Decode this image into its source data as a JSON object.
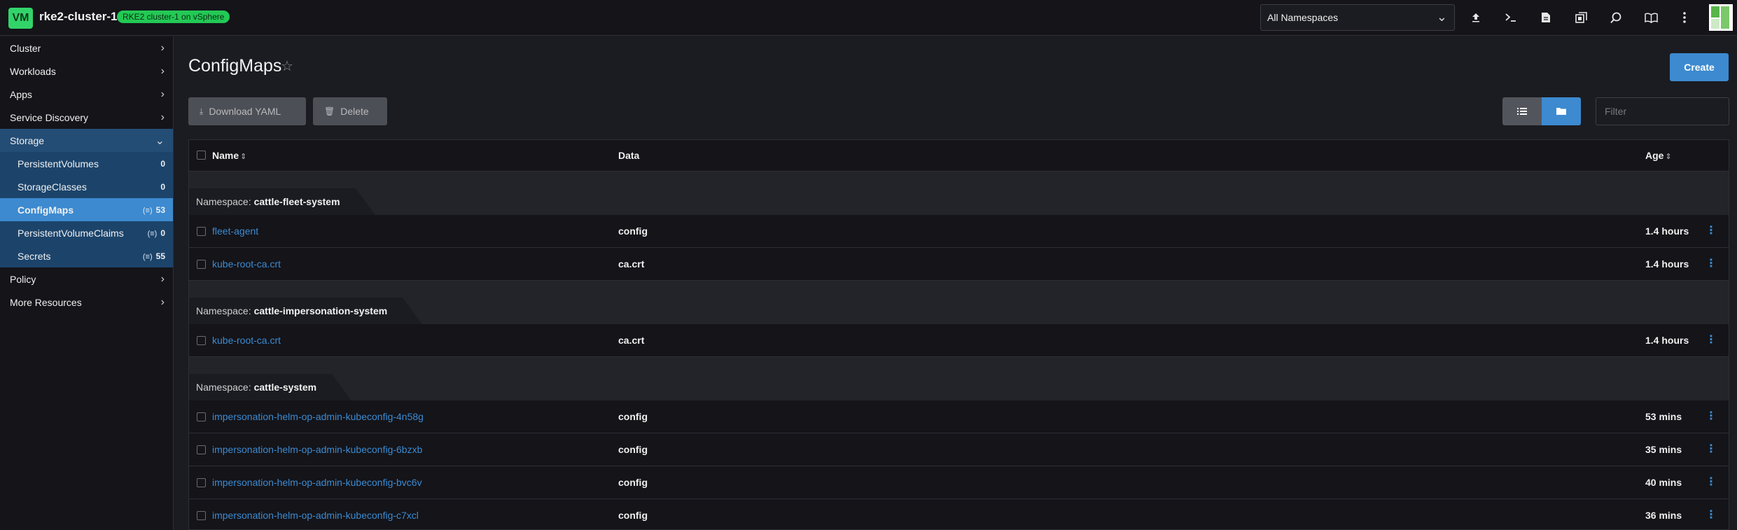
{
  "header": {
    "cluster_initials": "VM",
    "cluster_name": "rke2-cluster-1",
    "cluster_description": "RKE2 cluster-1 on vSphere",
    "namespace_select": "All Namespaces",
    "icons": [
      "upload-icon",
      "kubectl-shell-icon",
      "file-icon",
      "copy-kubeconfig-icon",
      "search-icon",
      "book-icon",
      "more-vertical-icon"
    ]
  },
  "sidebar": {
    "groups": [
      {
        "label": "Cluster"
      },
      {
        "label": "Workloads"
      },
      {
        "label": "Apps"
      },
      {
        "label": "Service Discovery"
      },
      {
        "label": "Storage"
      },
      {
        "label": "Policy"
      },
      {
        "label": "More Resources"
      }
    ],
    "storage_items": [
      {
        "label": "PersistentVolumes",
        "count": "0",
        "ns_glyph": ""
      },
      {
        "label": "StorageClasses",
        "count": "0",
        "ns_glyph": ""
      },
      {
        "label": "ConfigMaps",
        "count": "53",
        "ns_glyph": "(≡)"
      },
      {
        "label": "PersistentVolumeClaims",
        "count": "0",
        "ns_glyph": "(≡)"
      },
      {
        "label": "Secrets",
        "count": "55",
        "ns_glyph": "(≡)"
      }
    ]
  },
  "main": {
    "title": "ConfigMaps",
    "create_label": "Create",
    "download_label": "Download YAML",
    "delete_label": "Delete",
    "filter_placeholder": "Filter",
    "columns": {
      "name": "Name",
      "data": "Data",
      "age": "Age"
    },
    "namespace_prefix": "Namespace:",
    "groups": [
      {
        "namespace": "cattle-fleet-system",
        "rows": [
          {
            "name": "fleet-agent",
            "data": "config",
            "age": "1.4 hours"
          },
          {
            "name": "kube-root-ca.crt",
            "data": "ca.crt",
            "age": "1.4 hours"
          }
        ]
      },
      {
        "namespace": "cattle-impersonation-system",
        "rows": [
          {
            "name": "kube-root-ca.crt",
            "data": "ca.crt",
            "age": "1.4 hours"
          }
        ]
      },
      {
        "namespace": "cattle-system",
        "rows": [
          {
            "name": "impersonation-helm-op-admin-kubeconfig-4n58g",
            "data": "config",
            "age": "53 mins"
          },
          {
            "name": "impersonation-helm-op-admin-kubeconfig-6bzxb",
            "data": "config",
            "age": "35 mins"
          },
          {
            "name": "impersonation-helm-op-admin-kubeconfig-bvc6v",
            "data": "config",
            "age": "40 mins"
          },
          {
            "name": "impersonation-helm-op-admin-kubeconfig-c7xcl",
            "data": "config",
            "age": "36 mins"
          }
        ]
      }
    ]
  },
  "colors": {
    "accent": "#3d8ad0",
    "cluster_badge": "#32d46a",
    "nav_active": "#3d8ad0"
  }
}
